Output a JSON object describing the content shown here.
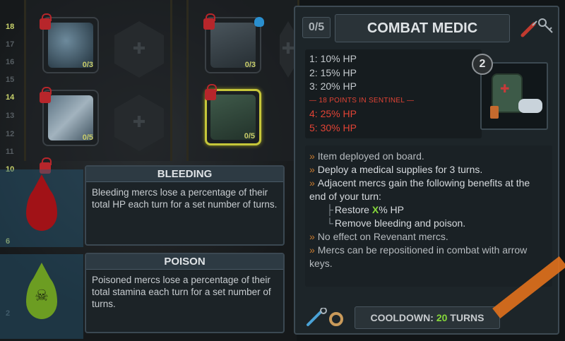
{
  "level_ruler": [
    "18",
    "17",
    "16",
    "15",
    "14",
    "13",
    "12",
    "11",
    "10",
    "6",
    "2"
  ],
  "skills": [
    {
      "name": "heart",
      "count": "0/3"
    },
    {
      "name": "megaphone",
      "count": "0/3"
    },
    {
      "name": "bandage",
      "count": "0/5"
    },
    {
      "name": "medkit",
      "count": "0/5"
    }
  ],
  "tooltips": {
    "bleeding": {
      "title": "BLEEDING",
      "text": "Bleeding mercs lose a percentage of their total HP each turn for a set number of turns."
    },
    "poison": {
      "title": "POISON",
      "text": "Poisoned mercs lose a percentage of their total stamina each turn for a set number of turns."
    }
  },
  "panel": {
    "rank": "0/5",
    "title": "COMBAT MEDIC",
    "item_level": "2",
    "tiers": [
      "1: 10% HP",
      "2: 15% HP",
      "3: 20% HP"
    ],
    "tier_separator": "— 18 POINTS IN SENTINEL —",
    "locked_tiers": [
      "4: 25% HP",
      "5: 30% HP"
    ],
    "effects": {
      "e1": "Item deployed on board.",
      "e2": "Deploy a medical supplies for 3 turns.",
      "e3": "Adjacent mercs gain the following benefits at the end of your turn:",
      "s1_pre": "Restore ",
      "s1_x": "X",
      "s1_post": "% HP",
      "s2": "Remove bleeding and poison.",
      "e4": "No effect on Revenant mercs.",
      "e5": "Mercs can be repositioned in combat with arrow keys."
    },
    "cooldown_label": "COOLDOWN: ",
    "cooldown_value": "20",
    "cooldown_unit": " TURNS"
  },
  "colors": {
    "accent_green": "#86d83a",
    "locked_red": "#e24335",
    "bullet_orange": "#c87a2e",
    "selection_yellow": "#c6c63a"
  }
}
